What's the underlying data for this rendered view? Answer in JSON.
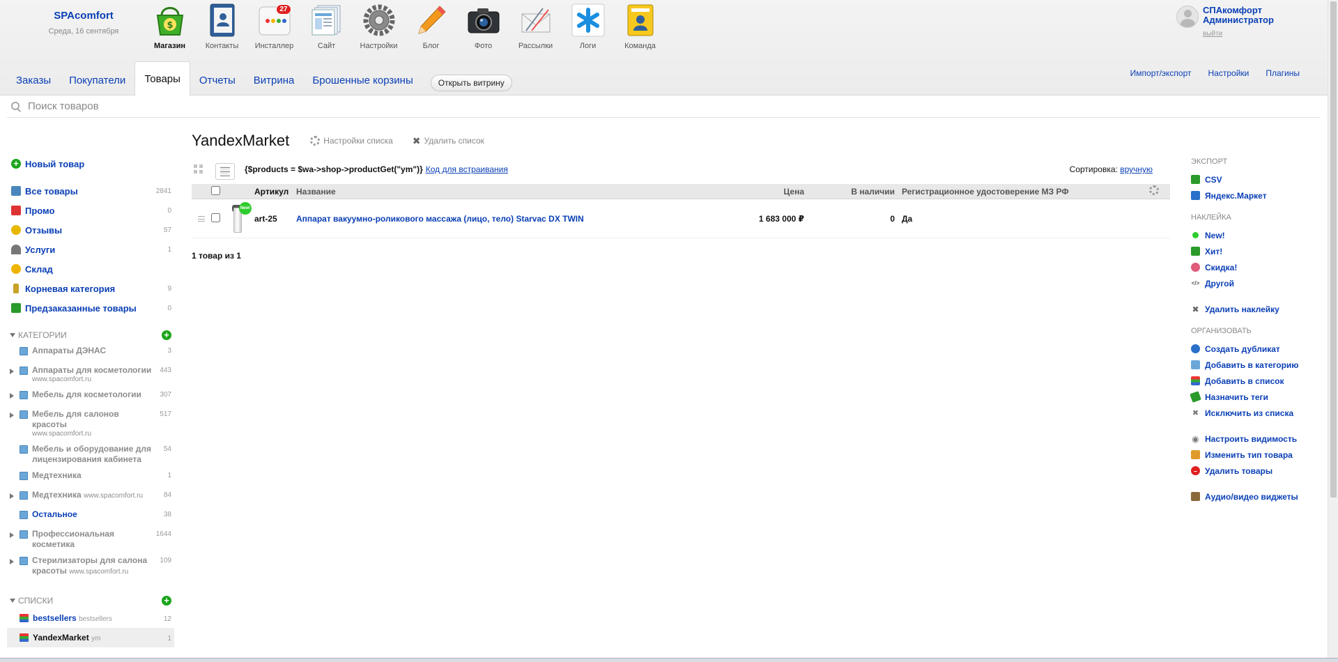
{
  "brand": {
    "name": "SPAcomfort",
    "date": "Среда, 16 сентября"
  },
  "apps": [
    {
      "label": "Магазин",
      "icon": "shop-basket-icon"
    },
    {
      "label": "Контакты",
      "icon": "contacts-book-icon"
    },
    {
      "label": "Инсталлер",
      "icon": "installer-icon",
      "badge": "27"
    },
    {
      "label": "Сайт",
      "icon": "site-pages-icon"
    },
    {
      "label": "Настройки",
      "icon": "gear-icon"
    },
    {
      "label": "Блог",
      "icon": "pencil-icon"
    },
    {
      "label": "Фото",
      "icon": "camera-icon"
    },
    {
      "label": "Рассылки",
      "icon": "mailer-icon"
    },
    {
      "label": "Логи",
      "icon": "asterisk-icon"
    },
    {
      "label": "Команда",
      "icon": "team-badge-icon"
    }
  ],
  "user": {
    "company": "СПАкомфорт",
    "role": "Администратор",
    "logout": "выйти"
  },
  "tabs": [
    {
      "label": "Заказы"
    },
    {
      "label": "Покупатели"
    },
    {
      "label": "Товары"
    },
    {
      "label": "Отчеты"
    },
    {
      "label": "Витрина"
    },
    {
      "label": "Брошенные корзины"
    }
  ],
  "open_store": "Открыть витрину",
  "top_links": [
    "Импорт/экспорт",
    "Настройки",
    "Плагины"
  ],
  "search": {
    "placeholder": "Поиск товаров"
  },
  "sidebar": {
    "new_item": "Новый товар",
    "nav": [
      {
        "label": "Все товары",
        "count": "2841",
        "color": "#4a86bb"
      },
      {
        "label": "Промо",
        "count": "0",
        "color": "#d33"
      },
      {
        "label": "Отзывы",
        "count": "57",
        "color": "#e6b800"
      },
      {
        "label": "Услуги",
        "count": "1",
        "color": "#666"
      },
      {
        "label": "Склад",
        "count": "",
        "color": "#f0b400"
      },
      {
        "label": "Корневая категория",
        "count": "9",
        "color": "#c9a227"
      },
      {
        "label": "Предзаказанные товары",
        "count": "0",
        "color": "#2a9a2a"
      }
    ],
    "categories_title": "КАТЕГОРИИ",
    "categories": [
      {
        "name": "Аппараты ДЭНАС",
        "sub": "",
        "count": "3",
        "expand": false
      },
      {
        "name": "Аппараты для косметологии",
        "sub": "www.spacomfort.ru",
        "count": "443",
        "expand": true
      },
      {
        "name": "Мебель для косметологии",
        "sub": "",
        "count": "307",
        "expand": true
      },
      {
        "name": "Мебель для салонов красоты",
        "sub": "www.spacomfort.ru",
        "count": "517",
        "expand": true
      },
      {
        "name": "Мебель и оборудование для лицензирования кабинета",
        "sub": "",
        "count": "54",
        "expand": false
      },
      {
        "name": "Медтехника",
        "sub": "",
        "count": "1",
        "expand": false
      },
      {
        "name": "Медтехника",
        "sub": "www.spacomfort.ru",
        "count": "84",
        "expand": true,
        "inline_sub": true
      },
      {
        "name": "Остальное",
        "sub": "",
        "count": "38",
        "expand": false,
        "dark": true
      },
      {
        "name": "Профессиональная косметика",
        "sub": "",
        "count": "1644",
        "expand": true
      },
      {
        "name": "Стерилизаторы для салона красоты",
        "sub": "www.spacomfort.ru",
        "count": "109",
        "expand": true,
        "inline_sub": true
      }
    ],
    "lists_title": "СПИСКИ",
    "lists": [
      {
        "name": "bestsellers",
        "sub": "bestsellers",
        "count": "12",
        "selected": false
      },
      {
        "name": "YandexMarket",
        "sub": "ym",
        "count": "1",
        "selected": true
      }
    ]
  },
  "main": {
    "title": "YandexMarket",
    "settings_label": "Настройки списка",
    "delete_label": "Удалить список",
    "embed_code": "{$products = $wa->shop->productGet(\"ym\")}",
    "embed_link": "Код для встраивания",
    "sort_label": "Сортировка:",
    "sort_value": "вручную",
    "columns": {
      "sku": "Артикул",
      "name": "Название",
      "price": "Цена",
      "stock": "В наличии",
      "reg": "Регистрационное удостоверение МЗ РФ"
    },
    "rows": [
      {
        "sku": "art-25",
        "name": "Аппарат вакуумно-роликового массажа (лицо, тело) Starvac DX TWIN",
        "price": "1 683 000 ₽",
        "stock": "0",
        "reg": "Да",
        "sticker": "New!"
      }
    ],
    "count_text": "1 товар из 1"
  },
  "right": {
    "export_title": "ЭКСПОРТ",
    "export": [
      {
        "label": "CSV",
        "color": "#2a9a2a"
      },
      {
        "label": "Яндекс.Маркет",
        "color": "#2a6fc9"
      }
    ],
    "sticker_title": "НАКЛЕЙКА",
    "stickers": [
      {
        "label": "New!",
        "color": "#2ecc2e"
      },
      {
        "label": "Хит!",
        "color": "#2a9a2a"
      },
      {
        "label": "Скидка!",
        "color": "#e05a7a"
      },
      {
        "label": "Другой",
        "color": "#555"
      }
    ],
    "remove_sticker": "Удалить наклейку",
    "organize_title": "ОРГАНИЗОВАТЬ",
    "organize": [
      {
        "label": "Создать дубликат",
        "color": "#2a6fc9"
      },
      {
        "label": "Добавить в категорию",
        "color": "#6aa7d8"
      },
      {
        "label": "Добавить в список",
        "color": "#d33"
      },
      {
        "label": "Назначить теги",
        "color": "#2a9a2a"
      },
      {
        "label": "Исключить из списка",
        "color": "#777"
      }
    ],
    "manage": [
      {
        "label": "Настроить видимость",
        "color": "#777"
      },
      {
        "label": "Изменить тип товара",
        "color": "#e09a2a"
      },
      {
        "label": "Удалить товары",
        "color": "#e02020"
      }
    ],
    "widgets": "Аудио/видео виджеты"
  }
}
